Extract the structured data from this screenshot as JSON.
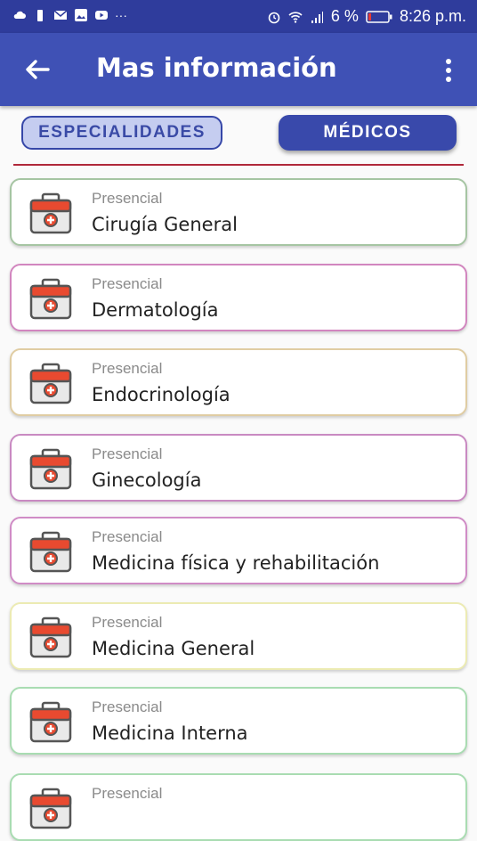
{
  "status_bar": {
    "icons": [
      "cloud-icon",
      "battery-saver-icon",
      "mail-icon",
      "image-icon",
      "youtube-icon",
      "more-notifications-icon"
    ],
    "more": "···",
    "battery_percent": "6 %",
    "time": "8:26 p.m."
  },
  "app_bar": {
    "title": "Mas información"
  },
  "tabs": {
    "specialties": "ESPECIALIDADES",
    "doctors": "MÉDICOS"
  },
  "colors": {
    "primary": "#3f51b5",
    "status": "#2f3c9c",
    "divider": "#b0283a"
  },
  "items": [
    {
      "mode": "Presencial",
      "name": "Cirugía General",
      "border": "#a6c5a3"
    },
    {
      "mode": "Presencial",
      "name": "Dermatología",
      "border": "#d286bf"
    },
    {
      "mode": "Presencial",
      "name": "Endocrinología",
      "border": "#e0cda3"
    },
    {
      "mode": "Presencial",
      "name": "Ginecología",
      "border": "#c98ac2"
    },
    {
      "mode": "Presencial",
      "name": "Medicina física y rehabilitación",
      "border": "#d08cc6"
    },
    {
      "mode": "Presencial",
      "name": "Medicina General",
      "border": "#ecebb3"
    },
    {
      "mode": "Presencial",
      "name": "Medicina Interna",
      "border": "#a9dcb2"
    },
    {
      "mode": "Presencial",
      "name": "",
      "border": "#a9dcb2"
    }
  ]
}
